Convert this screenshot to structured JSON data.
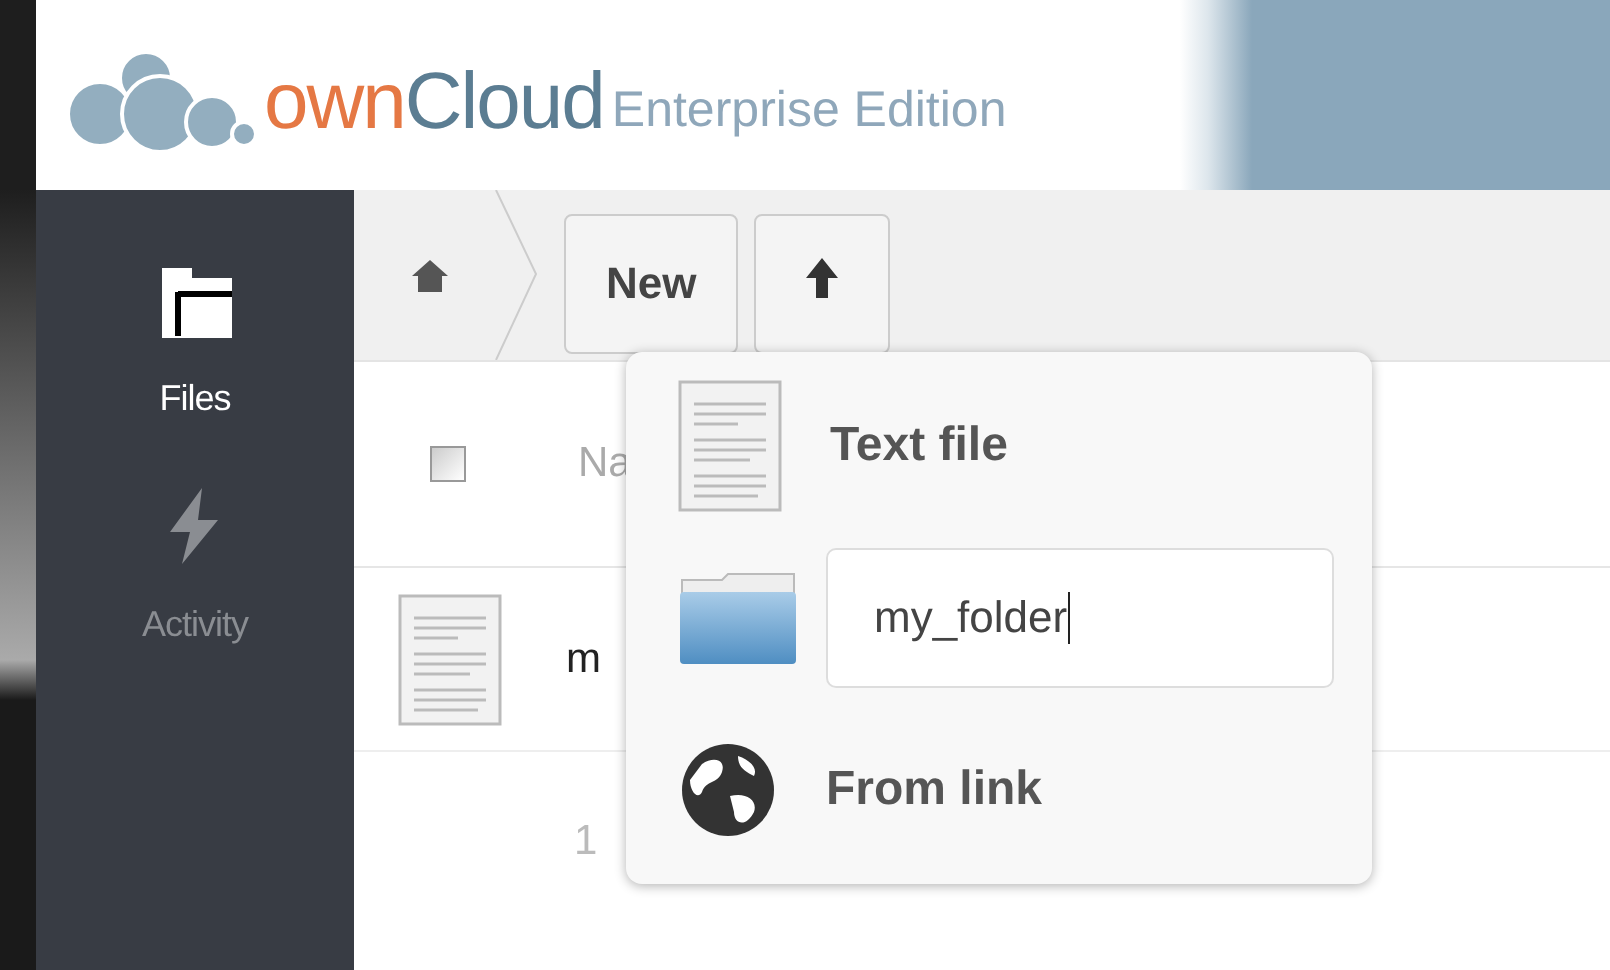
{
  "header": {
    "logo": {
      "part_1": "own",
      "part_2": "Cloud"
    },
    "edition": "Enterprise Edition"
  },
  "sidebar": {
    "items": [
      {
        "label": "Files",
        "kind": "files",
        "selected": true
      },
      {
        "label": "Activity",
        "kind": "activity",
        "selected": false
      }
    ]
  },
  "toolbar": {
    "new_button": "New"
  },
  "table": {
    "header": {
      "checked": false,
      "column_1": "Na"
    },
    "rows": [
      {
        "name": "m"
      }
    ],
    "footer": "1"
  },
  "new_menu": {
    "items": [
      {
        "kind": "text",
        "label": "Text file"
      },
      {
        "kind": "input",
        "value": "my_folder"
      },
      {
        "kind": "link",
        "label": "From link"
      }
    ]
  }
}
